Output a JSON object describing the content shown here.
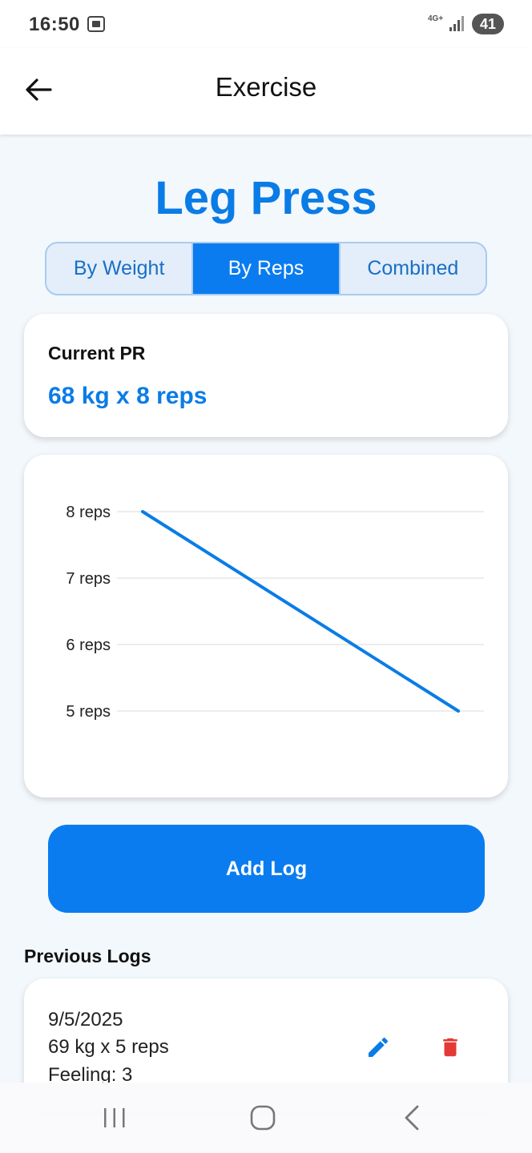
{
  "status_bar": {
    "time": "16:50",
    "network": "4G+",
    "battery": "41"
  },
  "app_bar": {
    "title": "Exercise",
    "back_icon": "arrow-left-icon"
  },
  "exercise": {
    "name": "Leg Press"
  },
  "tabs": [
    {
      "label": "By Weight",
      "active": false
    },
    {
      "label": "By Reps",
      "active": true
    },
    {
      "label": "Combined",
      "active": false
    }
  ],
  "pr_card": {
    "label": "Current PR",
    "value": "68 kg x 8 reps"
  },
  "chart_data": {
    "type": "line",
    "x": [
      0,
      1
    ],
    "series": [
      {
        "values": [
          8,
          5
        ],
        "color": "#0a7ce6"
      }
    ],
    "yticks": [
      8,
      7,
      6,
      5
    ],
    "ytick_labels": [
      "8 reps",
      "7 reps",
      "6 reps",
      "5 reps"
    ],
    "ylim": [
      5,
      8
    ],
    "grid": true
  },
  "add_log": {
    "label": "Add Log"
  },
  "previous_logs": {
    "title": "Previous Logs",
    "items": [
      {
        "date": "9/5/2025",
        "value": "69 kg x 5 reps",
        "feeling": "Feeling: 3"
      }
    ]
  },
  "colors": {
    "accent": "#0a7cf0",
    "title": "#0a7ce6",
    "delete": "#e53935",
    "background": "#f3f8fc"
  }
}
